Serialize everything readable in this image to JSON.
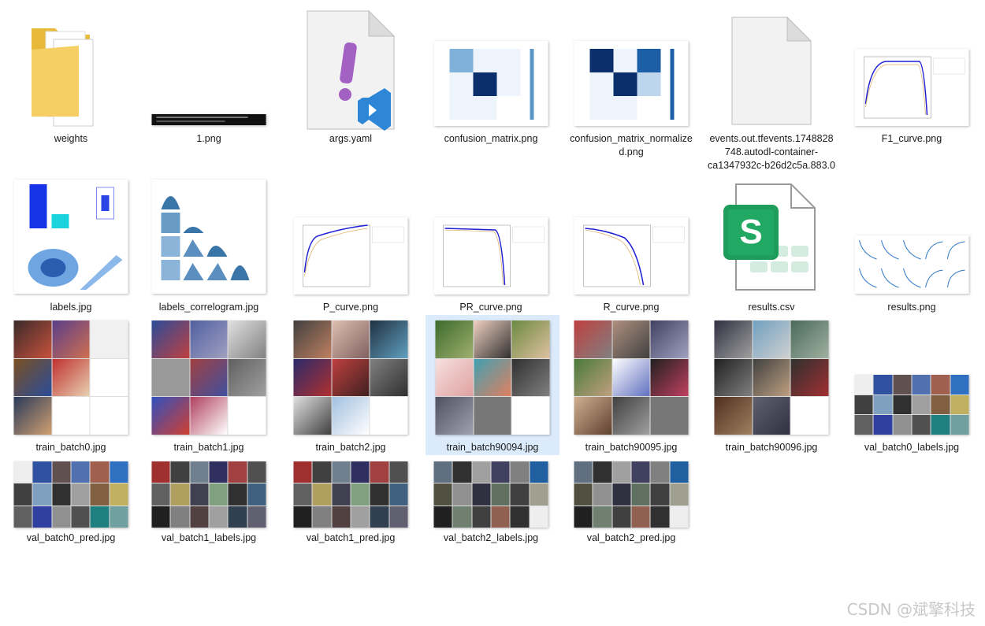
{
  "files": [
    {
      "name": "weights",
      "icon": "folder-icon"
    },
    {
      "name": "1.png",
      "icon": "terminal-image-icon"
    },
    {
      "name": "args.yaml",
      "icon": "yaml-file-icon"
    },
    {
      "name": "confusion_matrix.png",
      "icon": "confusion-matrix-thumbnail"
    },
    {
      "name": "confusion_matrix_normalized.png",
      "icon": "confusion-matrix-normalized-thumbnail"
    },
    {
      "name": "events.out.tfevents.1748828748.autodl-container-ca1347932c-b26d2c5a.883.0",
      "icon": "blank-file-icon"
    },
    {
      "name": "F1_curve.png",
      "icon": "f1-curve-thumbnail"
    },
    {
      "name": "labels.jpg",
      "icon": "labels-thumbnail"
    },
    {
      "name": "labels_correlogram.jpg",
      "icon": "correlogram-thumbnail"
    },
    {
      "name": "P_curve.png",
      "icon": "p-curve-thumbnail"
    },
    {
      "name": "PR_curve.png",
      "icon": "pr-curve-thumbnail"
    },
    {
      "name": "R_curve.png",
      "icon": "r-curve-thumbnail"
    },
    {
      "name": "results.csv",
      "icon": "spreadsheet-icon"
    },
    {
      "name": "results.png",
      "icon": "results-thumbnail"
    },
    {
      "name": "train_batch0.jpg",
      "icon": "photo-mosaic-thumbnail"
    },
    {
      "name": "train_batch1.jpg",
      "icon": "photo-mosaic-thumbnail"
    },
    {
      "name": "train_batch2.jpg",
      "icon": "photo-mosaic-thumbnail"
    },
    {
      "name": "train_batch90094.jpg",
      "icon": "photo-mosaic-thumbnail",
      "selected": true
    },
    {
      "name": "train_batch90095.jpg",
      "icon": "photo-mosaic-thumbnail"
    },
    {
      "name": "train_batch90096.jpg",
      "icon": "photo-mosaic-thumbnail"
    },
    {
      "name": "val_batch0_labels.jpg",
      "icon": "photo-mosaic-thumbnail"
    },
    {
      "name": "val_batch0_pred.jpg",
      "icon": "photo-mosaic-thumbnail"
    },
    {
      "name": "val_batch1_labels.jpg",
      "icon": "photo-mosaic-thumbnail"
    },
    {
      "name": "val_batch1_pred.jpg",
      "icon": "photo-mosaic-thumbnail"
    },
    {
      "name": "val_batch2_labels.jpg",
      "icon": "photo-mosaic-thumbnail"
    },
    {
      "name": "val_batch2_pred.jpg",
      "icon": "photo-mosaic-thumbnail"
    }
  ],
  "colors": {
    "selection": "#dcebfb",
    "folder": "#f5c94a",
    "spreadsheet": "#1e9c5a",
    "heatmap": "#0b2f6b",
    "curve": "#1f1fd6"
  },
  "watermark": "CSDN @斌擎科技"
}
